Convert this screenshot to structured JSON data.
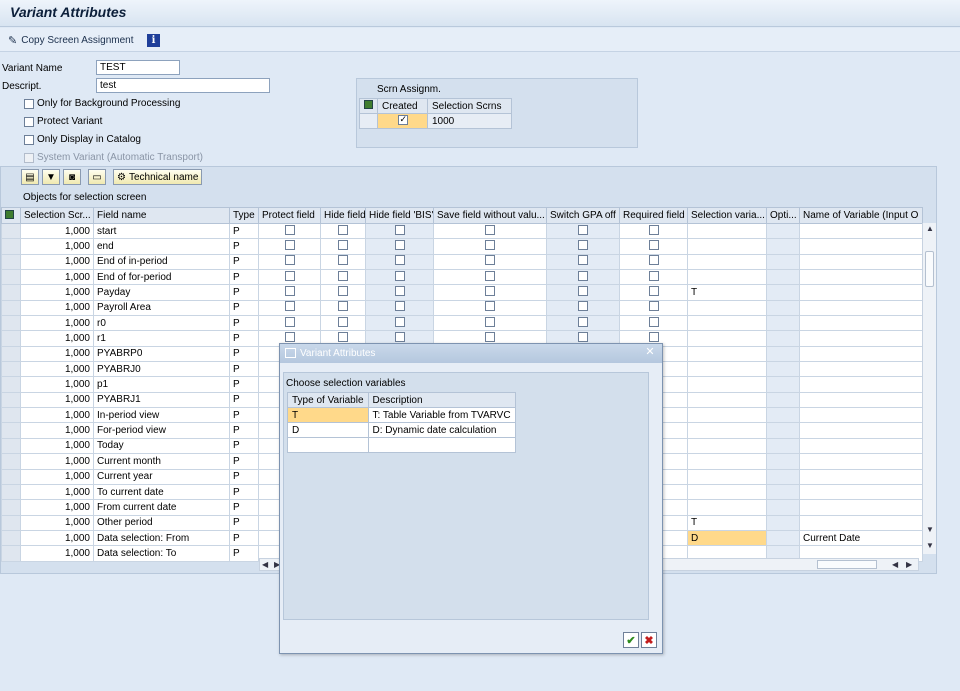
{
  "window": {
    "title": "Variant Attributes"
  },
  "toolbar": {
    "copy_label": "Copy Screen Assignment"
  },
  "form": {
    "variant_name_label": "Variant Name",
    "variant_name_value": "TEST",
    "descript_label": "Descript.",
    "descript_value": "test",
    "checkboxes": [
      {
        "label": "Only for Background Processing",
        "checked": false,
        "enabled": true
      },
      {
        "label": "Protect Variant",
        "checked": false,
        "enabled": true
      },
      {
        "label": "Only Display in Catalog",
        "checked": false,
        "enabled": true
      },
      {
        "label": "System Variant (Automatic Transport)",
        "checked": false,
        "enabled": false
      }
    ]
  },
  "scrn_assign": {
    "title": "Scrn Assignm.",
    "col_created": "Created",
    "col_screens": "Selection Scrns",
    "screen_value": "1000"
  },
  "main": {
    "technical_name_label": "Technical name",
    "objects_label": "Objects for selection screen",
    "columns": [
      "Selection Scr...",
      "Field name",
      "Type",
      "Protect field",
      "Hide field",
      "Hide field 'BIS'",
      "Save field without valu...",
      "Switch GPA off",
      "Required field",
      "Selection varia...",
      "Opti...",
      "Name of Variable (Input O"
    ],
    "rows": [
      {
        "scr": "1,000",
        "field": "start",
        "type": "P",
        "selvar": "",
        "name": ""
      },
      {
        "scr": "1,000",
        "field": "end",
        "type": "P",
        "selvar": "",
        "name": ""
      },
      {
        "scr": "1,000",
        "field": "End of in-period",
        "type": "P",
        "selvar": "",
        "name": ""
      },
      {
        "scr": "1,000",
        "field": "End of for-period",
        "type": "P",
        "selvar": "",
        "name": ""
      },
      {
        "scr": "1,000",
        "field": "Payday",
        "type": "P",
        "selvar": "T",
        "name": ""
      },
      {
        "scr": "1,000",
        "field": "Payroll Area",
        "type": "P",
        "selvar": "",
        "name": ""
      },
      {
        "scr": "1,000",
        "field": "r0",
        "type": "P",
        "selvar": "",
        "name": ""
      },
      {
        "scr": "1,000",
        "field": "r1",
        "type": "P",
        "selvar": "",
        "name": ""
      },
      {
        "scr": "1,000",
        "field": "PYABRP0",
        "type": "P",
        "selvar": "",
        "name": ""
      },
      {
        "scr": "1,000",
        "field": "PYABRJ0",
        "type": "P",
        "selvar": "",
        "name": ""
      },
      {
        "scr": "1,000",
        "field": "p1",
        "type": "P",
        "selvar": "",
        "name": ""
      },
      {
        "scr": "1,000",
        "field": "PYABRJ1",
        "type": "P",
        "selvar": "",
        "name": ""
      },
      {
        "scr": "1,000",
        "field": "In-period view",
        "type": "P",
        "selvar": "",
        "name": ""
      },
      {
        "scr": "1,000",
        "field": "For-period view",
        "type": "P",
        "selvar": "",
        "name": ""
      },
      {
        "scr": "1,000",
        "field": "Today",
        "type": "P",
        "selvar": "",
        "name": ""
      },
      {
        "scr": "1,000",
        "field": "Current month",
        "type": "P",
        "selvar": "",
        "name": ""
      },
      {
        "scr": "1,000",
        "field": "Current year",
        "type": "P",
        "selvar": "",
        "name": ""
      },
      {
        "scr": "1,000",
        "field": "To current date",
        "type": "P",
        "selvar": "",
        "name": ""
      },
      {
        "scr": "1,000",
        "field": "From current date",
        "type": "P",
        "selvar": "",
        "name": ""
      },
      {
        "scr": "1,000",
        "field": "Other period",
        "type": "P",
        "selvar": "T",
        "name": ""
      },
      {
        "scr": "1,000",
        "field": "Data selection: From",
        "type": "P",
        "selvar": "D",
        "name": "Current Date"
      },
      {
        "scr": "1,000",
        "field": "Data selection: To",
        "type": "P",
        "selvar": "",
        "name": ""
      }
    ]
  },
  "dialog": {
    "title": "Variant Attributes",
    "subtitle": "Choose selection variables",
    "col_type": "Type of Variable",
    "col_desc": "Description",
    "rows": [
      {
        "type": "T",
        "desc": "T: Table Variable from TVARVC"
      },
      {
        "type": "D",
        "desc": "D: Dynamic date calculation"
      }
    ]
  },
  "colors": {
    "accent_yellow": "#ffd98a",
    "panel_blue": "#d4e0ee"
  }
}
